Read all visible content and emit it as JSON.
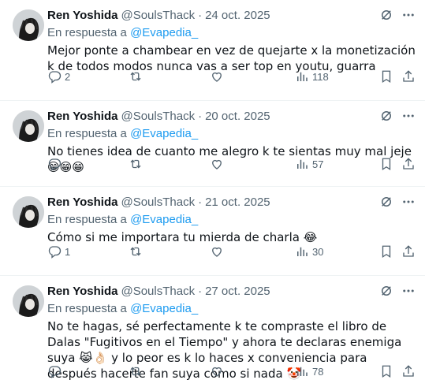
{
  "tweets": [
    {
      "name": "Ren Yoshida",
      "handle": "@SoulsThack",
      "date": "24 oct. 2025",
      "reply_prefix": "En respuesta a ",
      "reply_mention": "@Evapedia_",
      "text": "Mejor ponte a chambear en vez de quejarte x la monetización k de todos modos nunca vas a ser top en youtu, guarra",
      "replies": "2",
      "reposts": "",
      "likes": "",
      "views": "118"
    },
    {
      "name": "Ren Yoshida",
      "handle": "@SoulsThack",
      "date": "20 oct. 2025",
      "reply_prefix": "En respuesta a ",
      "reply_mention": "@Evapedia_",
      "text": "No tienes idea de cuanto me alegro k te sientas muy mal jeje 😁😁😁",
      "replies": "",
      "reposts": "",
      "likes": "",
      "views": "57"
    },
    {
      "name": "Ren Yoshida",
      "handle": "@SoulsThack",
      "date": "21 oct. 2025",
      "reply_prefix": "En respuesta a ",
      "reply_mention": "@Evapedia_",
      "text": "Cómo si me importara tu mierda de charla 😂",
      "replies": "1",
      "reposts": "",
      "likes": "",
      "views": "30"
    },
    {
      "name": "Ren Yoshida",
      "handle": "@SoulsThack",
      "date": "27 oct. 2025",
      "reply_prefix": "En respuesta a ",
      "reply_mention": "@Evapedia_",
      "text": "No te hagas, sé perfectamente k te compraste el libro de Dalas \"Fugitivos en el Tiempo\" y ahora te declaras enemiga suya 😹👌🏻 y lo peor es k lo haces x conveniencia para después hacerte fan suya como si nada 🤡",
      "replies": "",
      "reposts": "",
      "likes": "",
      "views": "78"
    }
  ],
  "icons": {
    "grok": "grok-icon",
    "more": "more-icon",
    "reply": "reply-icon",
    "repost": "repost-icon",
    "like": "like-icon",
    "views": "views-icon",
    "bookmark": "bookmark-icon",
    "share": "share-icon"
  },
  "colors": {
    "text": "#0f1419",
    "muted": "#536471",
    "link": "#1d9bf0",
    "divider": "#eff3f4"
  }
}
